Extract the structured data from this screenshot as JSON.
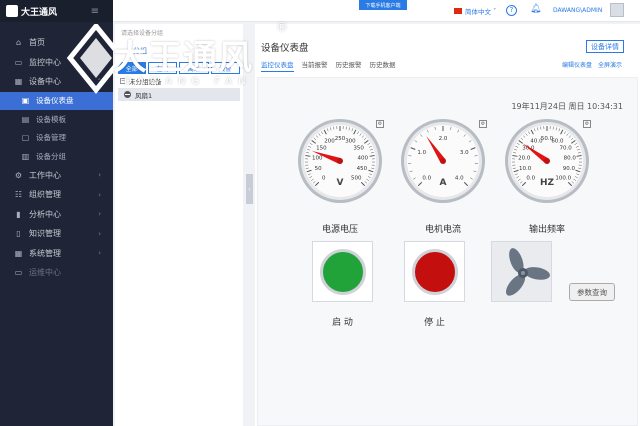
{
  "brand": {
    "logo_text": "大王通风",
    "watermark_title": "大王通风",
    "watermark_sub": "DAWANG FAN",
    "registered": "®"
  },
  "sidebar": {
    "menu_icon": "hamburger-icon",
    "items": [
      {
        "label": "首页",
        "icon": "home-icon"
      },
      {
        "label": "监控中心",
        "icon": "monitor-icon"
      },
      {
        "label": "设备中心",
        "icon": "grid-icon"
      }
    ],
    "subitems": [
      {
        "label": "设备仪表盘",
        "icon": "dashboard-icon",
        "active": true
      },
      {
        "label": "设备模板",
        "icon": "template-icon"
      },
      {
        "label": "设备管理",
        "icon": "device-icon"
      },
      {
        "label": "设备分组",
        "icon": "group-icon"
      }
    ],
    "items2": [
      {
        "label": "工作中心",
        "icon": "work-icon"
      },
      {
        "label": "组织管理",
        "icon": "org-icon"
      },
      {
        "label": "分析中心",
        "icon": "analysis-icon"
      },
      {
        "label": "知识管理",
        "icon": "knowledge-icon"
      },
      {
        "label": "系统管理",
        "icon": "system-icon"
      },
      {
        "label": "运维中心",
        "icon": "ops-icon"
      }
    ]
  },
  "topbar": {
    "download_label": "下载手机客户端",
    "language": "简体中文",
    "user": "DAWANG\\ADMIN"
  },
  "tree": {
    "header": "请选择设备分组",
    "add_group": "+ 分组",
    "buttons": [
      "全部",
      "在线",
      "离线",
      "报警"
    ],
    "root": "未分组设备",
    "child": "风扇1"
  },
  "main": {
    "title": "设备仪表盘",
    "detail_button": "设备详情",
    "tabs": [
      "监控仪表盘",
      "当前报警",
      "历史报警",
      "历史数据"
    ],
    "links": [
      "编辑仪表盘",
      "全屏演示"
    ],
    "time": "19年11月24日 周日 10:34:31"
  },
  "gauges": [
    {
      "caption": "电源电压",
      "unit": "V",
      "ticks": [
        "0",
        "50",
        "100",
        "150",
        "200",
        "250",
        "300",
        "350",
        "400",
        "450",
        "500"
      ],
      "max": 500,
      "value": 120
    },
    {
      "caption": "电机电流",
      "unit": "A",
      "ticks": [
        "0.0",
        "1.0",
        "2.0",
        "3.0",
        "4.0"
      ],
      "max": 4,
      "value": 1.5
    },
    {
      "caption": "输出频率",
      "unit": "HZ",
      "ticks": [
        "0.0",
        "10.0",
        "20.0",
        "30.0",
        "40.0",
        "50.0",
        "60.0",
        "70.0",
        "80.0",
        "90.0",
        "100.0"
      ],
      "max": 100,
      "value": 30
    }
  ],
  "controls": {
    "start_label": "启 动",
    "stop_label": "停 止",
    "query_label": "参数查询",
    "start_color": "#21a33a",
    "stop_color": "#c40f0f"
  }
}
